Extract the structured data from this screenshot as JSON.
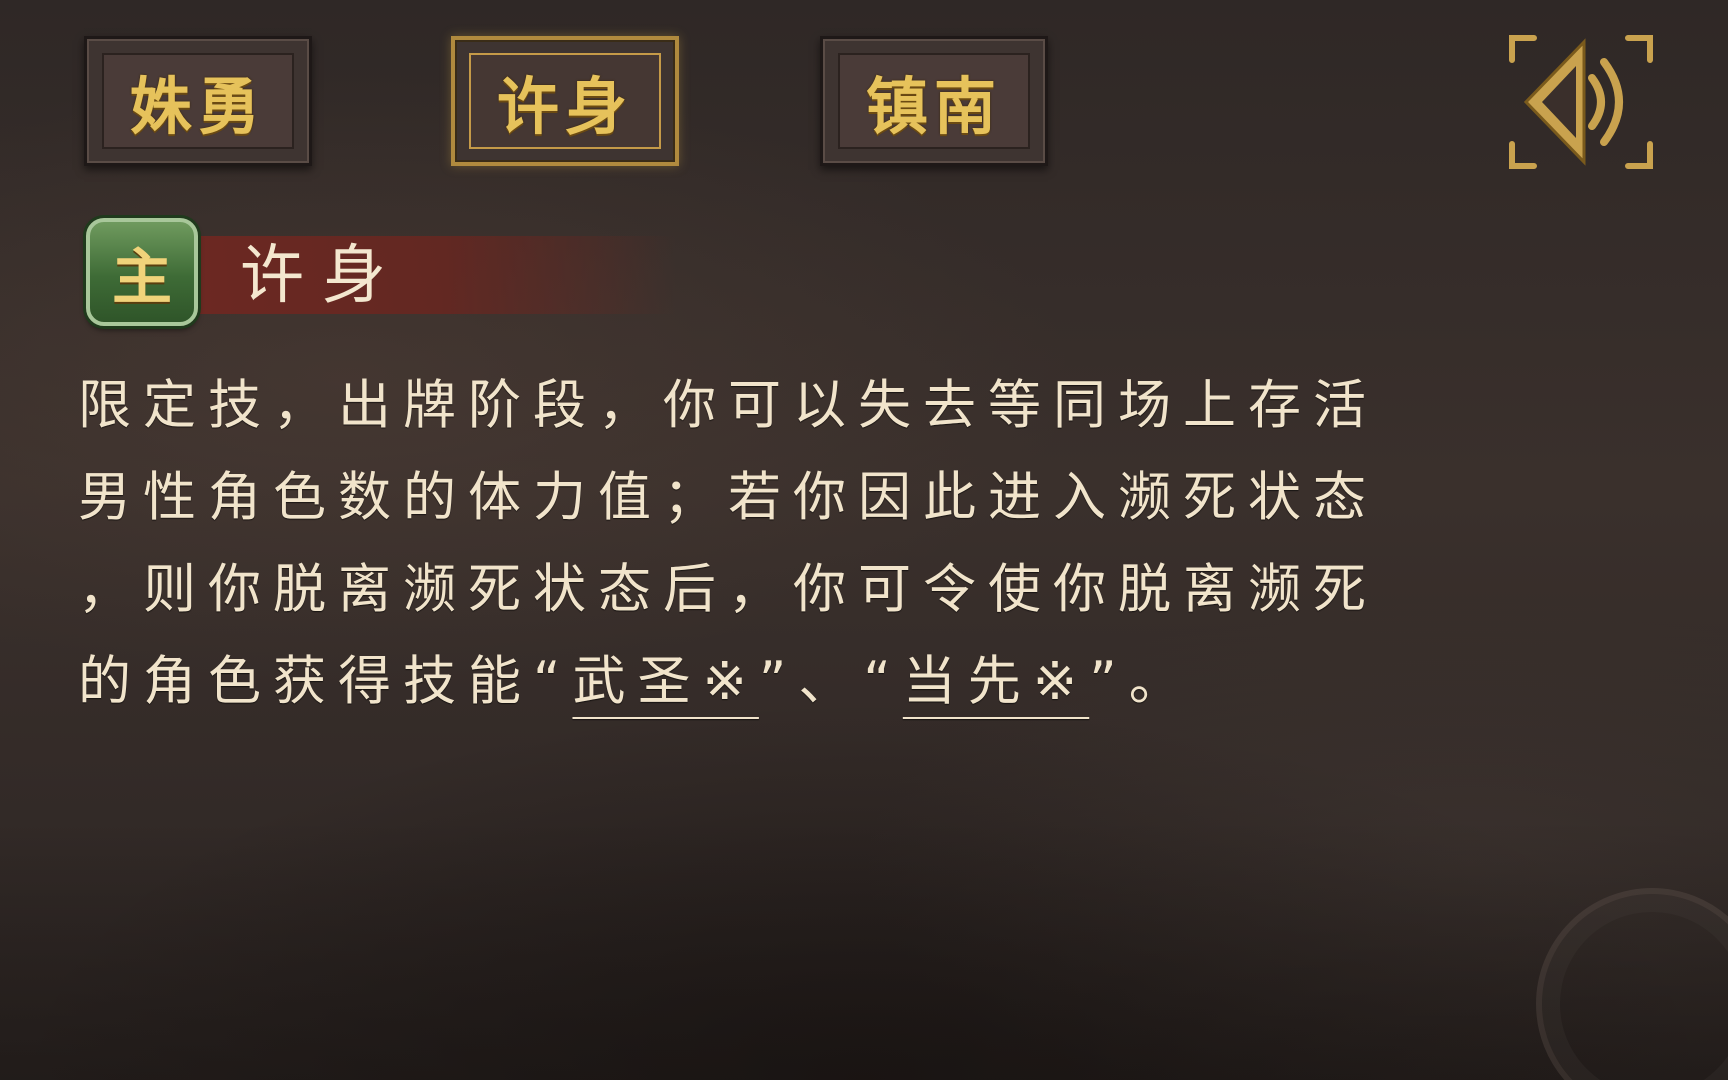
{
  "tabs": [
    {
      "label": "姝勇",
      "active": false
    },
    {
      "label": "许身",
      "active": true
    },
    {
      "label": "镇南",
      "active": false
    }
  ],
  "voice_button": {
    "icon": "speaker-icon"
  },
  "skill": {
    "badge": "主",
    "name": "许身",
    "description_lines": [
      {
        "text": "限定技，出牌阶段，你可以失去等同场上存活"
      },
      {
        "text": "男性角色数的体力值；若你因此进入濒死状态"
      },
      {
        "text": "，则你脱离濒死状态后，你可令使你脱离濒死"
      }
    ],
    "last_line": {
      "prefix": "的角色获得技能“",
      "link1": "武圣※",
      "middle": "”、“",
      "link2": "当先※",
      "suffix": "”。"
    }
  },
  "colors": {
    "gold_text": "#e6c25b",
    "body_text": "#f1e4cb",
    "ribbon_red": "#702822",
    "badge_green": "#3e6b36"
  }
}
